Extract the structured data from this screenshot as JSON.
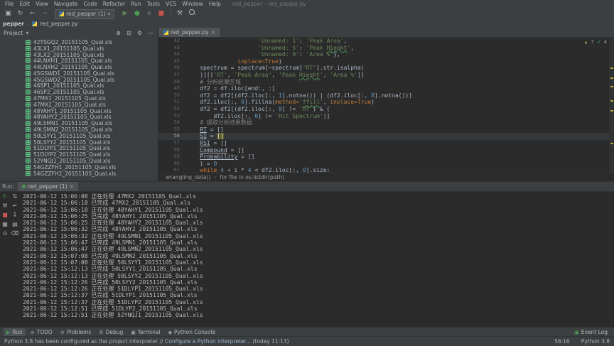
{
  "window": {
    "title": "red_pepper - red_pepper.py",
    "menus": [
      "File",
      "Edit",
      "View",
      "Navigate",
      "Code",
      "Refactor",
      "Run",
      "Tools",
      "VCS",
      "Window",
      "Help"
    ]
  },
  "icons": {
    "save": "▣",
    "sync": "↻",
    "back": "←",
    "forward": "→",
    "run": "▶",
    "debug": "●",
    "coverage": "◈",
    "stop": "■",
    "wrench": "⚒",
    "chevron": "▾",
    "close": "×",
    "locate": "⊕",
    "collapse": "⊟",
    "gear": "⚙",
    "hide": "—",
    "warn": "▲",
    "ok": "✔",
    "crumb_sep": "›",
    "tree_chevron": "▾"
  },
  "colors": {
    "run_green": "#499C54",
    "stop_red": "#C75450",
    "warn_yellow": "#b8a23a",
    "string_green": "#6a8759",
    "keyword_orange": "#cc7832",
    "number_blue": "#6897bb",
    "panel_bg": "#3c3f41",
    "editor_bg": "#2b2b2b"
  },
  "toolbar": {
    "run_config": "red_pepper (1)"
  },
  "navbar": {
    "crumbs": [
      "pepper",
      "red_pepper.py"
    ]
  },
  "project": {
    "title": "Project",
    "files": [
      "42TSGQ2_20151105_Qual.xls",
      "43LX1_20151105_Qual.xls",
      "43LX2_20151105_Qual.xls",
      "44LNXH1_20151105_Qual.xls",
      "44LNXH2_20151105_Qual.xls",
      "45GSWD1_20151105_Qual.xls",
      "45GSWD2_20151105_Qual.xls",
      "46SP1_20151105_Qual.xls",
      "46SP2_20151105_Qual.xls",
      "47MX1_20151105_Qual.xls",
      "47MX2_20151105_Qual.xls",
      "48YAHY1_20151105_Qual.xls",
      "48YAHY2_20151105_Qual.xls",
      "49LSMN1_20151105_Qual.xls",
      "49LSMN2_20151105_Qual.xls",
      "50LSYY1_20151105_Qual.xls",
      "50LSYY2_20151105_Qual.xls",
      "51DLYP1_20151105_Qual.xls",
      "51DLYP2_20151105_Qual.xls",
      "52YNQJ1_20151105_Qual.xls",
      "54GZZFH1_20151105_Qual.xls",
      "54GZZFH2_20151105_Qual.xls"
    ]
  },
  "editor": {
    "tab": "red_pepper.py",
    "inspections": {
      "warnings": "7",
      "ok": "4"
    },
    "breadcrumbs": [
      "wrangling_data()",
      "for file in os.listdir(path)"
    ],
    "lines": [
      {
        "n": "42",
        "seg": [
          [
            "                     ",
            "t"
          ],
          [
            "'Unnamed: 1'",
            "s"
          ],
          [
            ": ",
            "t"
          ],
          [
            "'Peak Area'",
            "s"
          ],
          [
            ",",
            "t"
          ]
        ]
      },
      {
        "n": "43",
        "seg": [
          [
            "                     ",
            "t"
          ],
          [
            "'Unnamed: 5'",
            "s"
          ],
          [
            ": ",
            "t"
          ],
          [
            "'Peak ",
            "s"
          ],
          [
            "Hieght",
            "su"
          ],
          [
            "'",
            "s"
          ],
          [
            ",",
            "t"
          ]
        ]
      },
      {
        "n": "44",
        "seg": [
          [
            "                     ",
            "t"
          ],
          [
            "'Unnamed: 9'",
            "s"
          ],
          [
            ": ",
            "t"
          ],
          [
            "'Area %'",
            "s"
          ],
          [
            "},",
            "t"
          ]
        ]
      },
      {
        "n": "45",
        "seg": [
          [
            "               ",
            "t"
          ],
          [
            "inplace=",
            "p"
          ],
          [
            "True",
            "k"
          ],
          [
            ")",
            "t"
          ]
        ]
      },
      {
        "n": "46",
        "seg": [
          [
            "    spectrum = spectrum[~spectrum[",
            "t"
          ],
          [
            "'RT'",
            "s"
          ],
          [
            "].str.isalpha(",
            "t"
          ]
        ]
      },
      {
        "n": "47",
        "seg": [
          [
            "    )][[",
            "t"
          ],
          [
            "'RT'",
            "s"
          ],
          [
            ", ",
            "t"
          ],
          [
            "'Peak Area'",
            "s"
          ],
          [
            ", ",
            "t"
          ],
          [
            "'Peak ",
            "s"
          ],
          [
            "Hieght",
            "su"
          ],
          [
            "'",
            "s"
          ],
          [
            ", ",
            "t"
          ],
          [
            "'Area %'",
            "s"
          ],
          [
            "]]",
            "t"
          ]
        ]
      },
      {
        "n": "48",
        "seg": [
          [
            "    ",
            "t"
          ],
          [
            "# 分析结果区域",
            "c"
          ]
        ]
      },
      {
        "n": "49",
        "seg": [
          [
            "    df2 = df.iloc[end:, :]",
            "t"
          ]
        ]
      },
      {
        "n": "50",
        "seg": [
          [
            "    df2 = df2[(df2.iloc[:, ",
            "t"
          ],
          [
            "1",
            "n"
          ],
          [
            "].notna()) | (df2.iloc[:, ",
            "t"
          ],
          [
            "8",
            "n"
          ],
          [
            "].notna())]",
            "t"
          ]
        ]
      },
      {
        "n": "51",
        "seg": [
          [
            "    df2.iloc[:, ",
            "t"
          ],
          [
            "0",
            "n"
          ],
          [
            "].fillna(",
            "t"
          ],
          [
            "method=",
            "p"
          ],
          [
            "'",
            "s"
          ],
          [
            "ffill",
            "su"
          ],
          [
            "'",
            "s"
          ],
          [
            ", ",
            "t"
          ],
          [
            "inplace=",
            "p"
          ],
          [
            "True",
            "k"
          ],
          [
            ")",
            "t"
          ]
        ]
      },
      {
        "n": "52",
        "seg": [
          [
            "    df2 = df2[(df2.iloc[:, ",
            "t"
          ],
          [
            "0",
            "n"
          ],
          [
            "] != ",
            "t"
          ],
          [
            "'RT'",
            "s"
          ],
          [
            ") & (",
            "t"
          ]
        ]
      },
      {
        "n": "53",
        "seg": [
          [
            "        df2.iloc[:, ",
            "t"
          ],
          [
            "0",
            "n"
          ],
          [
            "] != ",
            "t"
          ],
          [
            "'Hit Spectrum'",
            "s"
          ],
          [
            ")]",
            "t"
          ]
        ]
      },
      {
        "n": "54",
        "seg": [
          [
            "    ",
            "t"
          ],
          [
            "# 提取分析结果数据",
            "c"
          ]
        ]
      },
      {
        "n": "55",
        "seg": [
          [
            "    ",
            "t"
          ],
          [
            "RT",
            "u"
          ],
          [
            " = []",
            "t"
          ]
        ]
      },
      {
        "n": "56",
        "cur": true,
        "seg": [
          [
            "    ",
            "t"
          ],
          [
            "SI",
            "u"
          ],
          [
            " = ",
            "t"
          ],
          [
            "[]",
            "hl"
          ]
        ]
      },
      {
        "n": "57",
        "seg": [
          [
            "    ",
            "t"
          ],
          [
            "RSI",
            "u"
          ],
          [
            " = []",
            "t"
          ]
        ]
      },
      {
        "n": "58",
        "seg": [
          [
            "    ",
            "t"
          ],
          [
            "Compound",
            "u"
          ],
          [
            " = []",
            "t"
          ]
        ]
      },
      {
        "n": "59",
        "seg": [
          [
            "    ",
            "t"
          ],
          [
            "Probability",
            "u"
          ],
          [
            " = []",
            "t"
          ]
        ]
      },
      {
        "n": "60",
        "seg": [
          [
            "    i = ",
            "t"
          ],
          [
            "0",
            "n"
          ]
        ]
      },
      {
        "n": "61",
        "seg": [
          [
            "    ",
            "t"
          ],
          [
            "while ",
            "k"
          ],
          [
            "4",
            "n"
          ],
          [
            " + i * ",
            "t"
          ],
          [
            "4",
            "n"
          ],
          [
            " < df2.iloc[:, ",
            "t"
          ],
          [
            "0",
            "n"
          ],
          [
            "].size:",
            "t"
          ]
        ]
      }
    ]
  },
  "run": {
    "header_label": "Run:",
    "tab": "red_pepper (1)",
    "toolbar_col1": [
      {
        "name": "rerun-icon",
        "glyph": "↻",
        "color": "#499C54"
      },
      {
        "name": "settings-icon",
        "glyph": "⚒",
        "color": "#afb1b3"
      },
      {
        "name": "stop-icon",
        "glyph": "■",
        "color": "#C75450"
      },
      {
        "name": "restore-layout-icon",
        "glyph": "▦",
        "color": "#afb1b3"
      },
      {
        "name": "pin-icon",
        "glyph": "⊙",
        "color": "#afb1b3"
      }
    ],
    "toolbar_col2": [
      {
        "name": "stacktrace-arrows-icon",
        "glyph": "⇅",
        "color": "#afb1b3"
      },
      {
        "name": "soft-wrap-icon",
        "glyph": "↵",
        "color": "#afb1b3"
      },
      {
        "name": "scroll-to-end-icon",
        "glyph": "↧",
        "color": "#afb1b3"
      },
      {
        "name": "print-icon",
        "glyph": "▤",
        "color": "#afb1b3"
      },
      {
        "name": "clear-all-icon",
        "glyph": "⌫",
        "color": "#afb1b3"
      }
    ],
    "lines": [
      {
        "time": "2021-06-12 15:06:08",
        "status": "正在处理",
        "file": "47MX2_20151105_Qual.xls"
      },
      {
        "time": "2021-06-12 15:06:18",
        "status": "已完成",
        "file": "47MX2_20151105_Qual.xls"
      },
      {
        "time": "2021-06-12 15:06:18",
        "status": "正在处理",
        "file": "48YAHY1_20151105_Qual.xls"
      },
      {
        "time": "2021-06-12 15:06:25",
        "status": "已完成",
        "file": "48YAHY1_20151105_Qual.xls"
      },
      {
        "time": "2021-06-12 15:06:25",
        "status": "正在处理",
        "file": "48YAHY2_20151105_Qual.xls"
      },
      {
        "time": "2021-06-12 15:06:32",
        "status": "已完成",
        "file": "48YAHY2_20151105_Qual.xls"
      },
      {
        "time": "2021-06-12 15:06:32",
        "status": "正在处理",
        "file": "49LSMN1_20151105_Qual.xls"
      },
      {
        "time": "2021-06-12 15:06:47",
        "status": "已完成",
        "file": "49LSMN1_20151105_Qual.xls"
      },
      {
        "time": "2021-06-12 15:06:47",
        "status": "正在处理",
        "file": "49LSMN2_20151105_Qual.xls"
      },
      {
        "time": "2021-06-12 15:07:08",
        "status": "已完成",
        "file": "49LSMN2_20151105_Qual.xls"
      },
      {
        "time": "2021-06-12 15:07:08",
        "status": "正在处理",
        "file": "50LSYY1_20151105_Qual.xls"
      },
      {
        "time": "2021-06-12 15:12:13",
        "status": "已完成",
        "file": "50LSYY1_20151105_Qual.xls"
      },
      {
        "time": "2021-06-12 15:12:13",
        "status": "正在处理",
        "file": "50LSYY2_20151105_Qual.xls"
      },
      {
        "time": "2021-06-12 15:12:26",
        "status": "已完成",
        "file": "50LSYY2_20151105_Qual.xls"
      },
      {
        "time": "2021-06-12 15:12:26",
        "status": "正在处理",
        "file": "51DLYP1_20151105_Qual.xls"
      },
      {
        "time": "2021-06-12 15:12:37",
        "status": "已完成",
        "file": "51DLYP1_20151105_Qual.xls"
      },
      {
        "time": "2021-06-12 15:12:37",
        "status": "正在处理",
        "file": "51DLYP2_20151105_Qual.xls"
      },
      {
        "time": "2021-06-12 15:12:51",
        "status": "已完成",
        "file": "51DLYP2_20151105_Qual.xls"
      },
      {
        "time": "2021-06-12 15:12:51",
        "status": "正在处理",
        "file": "52YNQJ1_20151105_Qual.xls"
      }
    ]
  },
  "stripe": {
    "buttons": [
      {
        "label": "Run",
        "glyph": "▶",
        "icon": "play-icon",
        "active": true,
        "green": true
      },
      {
        "label": "TODO",
        "glyph": "≡",
        "icon": "todo-icon"
      },
      {
        "label": "Problems",
        "glyph": "⊘",
        "icon": "problems-icon"
      },
      {
        "label": "Debug",
        "glyph": "⚙",
        "icon": "debug-icon"
      },
      {
        "label": "Terminal",
        "glyph": "▣",
        "icon": "terminal-icon"
      },
      {
        "label": "Python Console",
        "glyph": "◆",
        "icon": "python-console-icon"
      }
    ],
    "event_log": "Event Log"
  },
  "statusbar": {
    "message_main": "Python 3.8 has been configured as the project interpreter // ",
    "message_link": "Configure a Python interpreter...",
    "message_note": " (today 11:13)",
    "caret": "56:16",
    "interpreter": "Python 3.8"
  }
}
